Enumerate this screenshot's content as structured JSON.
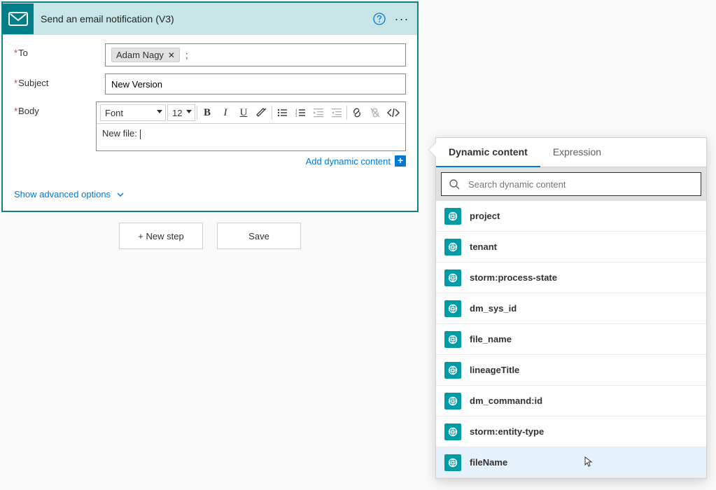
{
  "action": {
    "title": "Send an email notification (V3)",
    "fields": {
      "to_label": "To",
      "subject_label": "Subject",
      "body_label": "Body"
    },
    "to_chip": "Adam Nagy",
    "to_trailing": ";",
    "subject_value": "New Version",
    "body_text": "New file: ",
    "toolbar": {
      "font_label": "Font",
      "size_label": "12"
    },
    "add_dynamic_content": "Add dynamic content",
    "show_advanced": "Show advanced options"
  },
  "buttons": {
    "new_step": "+ New step",
    "save": "Save"
  },
  "flyout": {
    "tab_dynamic": "Dynamic content",
    "tab_expression": "Expression",
    "search_placeholder": "Search dynamic content",
    "items": [
      {
        "label": "project"
      },
      {
        "label": "tenant"
      },
      {
        "label": "storm:process-state"
      },
      {
        "label": "dm_sys_id"
      },
      {
        "label": "file_name"
      },
      {
        "label": "lineageTitle"
      },
      {
        "label": "dm_command:id"
      },
      {
        "label": "storm:entity-type"
      },
      {
        "label": "fileName",
        "hover": true
      }
    ]
  }
}
